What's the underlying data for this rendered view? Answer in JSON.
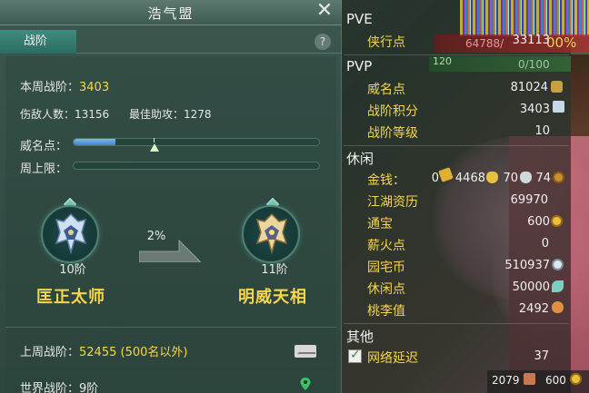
{
  "window": {
    "title": "浩气盟"
  },
  "tabs": [
    {
      "label": "战阶"
    }
  ],
  "stats": {
    "week_rank_label": "本周战阶：",
    "week_rank_value": "3403",
    "kills_label": "伤敌人数：",
    "kills_value": "13156",
    "assist_label": "最佳助攻：",
    "assist_value": "1278",
    "prestige_label": "威名点：",
    "prestige_progress": 0.17,
    "week_cap_label": "周上限：",
    "week_cap_progress": 0.0
  },
  "ranks": {
    "current": {
      "level": "10阶",
      "title": "匡正太师"
    },
    "next": {
      "level": "11阶",
      "title": "明威天相"
    },
    "progress_pct": "2%"
  },
  "footer": {
    "last_week_label": "上周战阶：",
    "last_week_value": "52455 (500名以外)",
    "world_rank_label": "世界战阶：",
    "world_rank_value": "9阶"
  },
  "right": {
    "pve": {
      "title": "PVE",
      "items": [
        {
          "label": "侠行点",
          "value": "33113"
        }
      ]
    },
    "pvp": {
      "title": "PVP",
      "items": [
        {
          "label": "威名点",
          "value": "81024"
        },
        {
          "label": "战阶积分",
          "value": "3403"
        },
        {
          "label": "战阶等级",
          "value": "10"
        }
      ]
    },
    "leisure": {
      "title": "休闲",
      "money_label": "金钱：",
      "money_zhuan": "0",
      "money_jin": "4468",
      "money_yin": "70",
      "money_tong": "74",
      "items": [
        {
          "label": "江湖资历",
          "value": "69970"
        },
        {
          "label": "通宝",
          "value": "600"
        },
        {
          "label": "薪火点",
          "value": "0"
        },
        {
          "label": "园宅币",
          "value": "510937"
        },
        {
          "label": "休闲点",
          "value": "50000"
        },
        {
          "label": "桃李值",
          "value": "2492"
        }
      ]
    },
    "other": {
      "title": "其他",
      "latency_label": "网络延迟",
      "latency_value": "37"
    }
  },
  "hud": {
    "exp_text": "64788/",
    "exp_pct": "00%",
    "level_badge": "120",
    "stamina_text": "0/100",
    "bottom_left": "2079",
    "bottom_right": "600"
  },
  "colors": {
    "accent_yellow": "#f5d64a",
    "tab_green": "#3f8c7e",
    "bar_blue": "#3f82c8"
  }
}
